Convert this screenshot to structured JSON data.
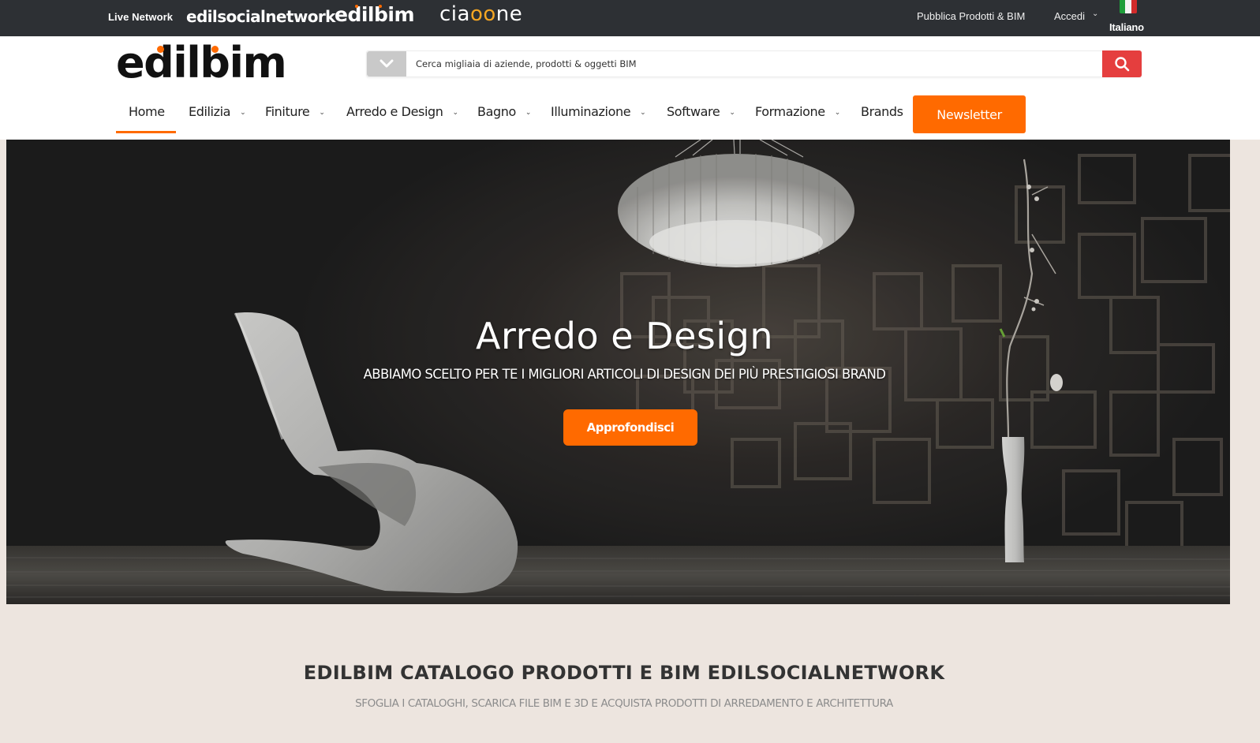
{
  "topbar": {
    "live_network_label": "Live Network",
    "network_sites": [
      "edilsocialnetwork",
      "edilbim",
      "ciaoone"
    ],
    "publish_link": "Pubblica Prodotti & BIM",
    "login_label": "Accedi",
    "language_label": "Italiano",
    "language_flag_colors": [
      "#1f9e3a",
      "#f4f4f4",
      "#d22b2b"
    ]
  },
  "header": {
    "logo_text": "edilbim",
    "search": {
      "placeholder": "Cerca migliaia di aziende, prodotti & oggetti BIM",
      "value": "",
      "category_icon": "chevron-down-icon",
      "submit_icon": "search-icon"
    },
    "nav": [
      {
        "label": "Home",
        "dropdown": false,
        "active": true
      },
      {
        "label": "Edilizia",
        "dropdown": true
      },
      {
        "label": "Finiture",
        "dropdown": true
      },
      {
        "label": "Arredo e Design",
        "dropdown": true
      },
      {
        "label": "Bagno",
        "dropdown": true
      },
      {
        "label": "Illuminazione",
        "dropdown": true
      },
      {
        "label": "Software",
        "dropdown": true
      },
      {
        "label": "Formazione",
        "dropdown": true
      },
      {
        "label": "Brands",
        "dropdown": false
      }
    ],
    "newsletter_label": "Newsletter",
    "chevron_glyph": "⌄"
  },
  "hero": {
    "title": "Arredo e Design",
    "subtitle": "ABBIAMO SCELTO PER TE I MIGLIORI ARTICOLI DI DESIGN DEI PIÙ PRESTIGIOSI BRAND",
    "cta_label": "Approfondisci"
  },
  "intro": {
    "title": "EDILBIM CATALOGO PRODOTTI E BIM EDILSOCIALNETWORK",
    "subtitle": "SFOGLIA I CATALOGHI, SCARICA FILE BIM E 3D E ACQUISTA PRODOTTI DI ARREDAMENTO E ARCHITETTURA"
  },
  "colors": {
    "accent_orange": "#ff6a00",
    "search_red": "#e53e3e",
    "topbar_bg": "#2d3034",
    "page_bg": "#ede5df"
  }
}
